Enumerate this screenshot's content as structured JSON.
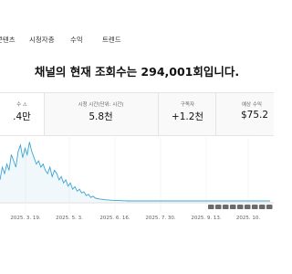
{
  "tabs": [
    "콘텐츠",
    "시청자층",
    "수익",
    "트렌드"
  ],
  "headline": "채널의 현재 조회수는 294,001회입니다.",
  "metrics": [
    {
      "label": "수 ⚠",
      "value": ".4만"
    },
    {
      "label": "시청 시간(단위: 시간)",
      "value": "5.8천"
    },
    {
      "label": "구독자",
      "value": "+1.2천"
    },
    {
      "label": "예상 수익",
      "value": "$75.2"
    }
  ],
  "colors": {
    "line": "#3ea6d1",
    "accent": "#065fd4"
  },
  "chart_data": {
    "type": "line",
    "x_tick_labels": [
      "2025. 3. 19.",
      "2025. 5. 3.",
      "2025. 6. 16.",
      "2025. 7. 30.",
      "2025. 9. 13.",
      "2025. 10."
    ],
    "series": [
      {
        "values": [
          0.35,
          0.55,
          0.45,
          0.6,
          0.5,
          0.75,
          0.65,
          0.55,
          0.8,
          0.9,
          0.7,
          0.85,
          0.75,
          0.95,
          0.8,
          0.7,
          0.6,
          0.65,
          0.55,
          0.6,
          0.5,
          0.45,
          0.55,
          0.4,
          0.5,
          0.45,
          0.35,
          0.4,
          0.3,
          0.35,
          0.25,
          0.3,
          0.2,
          0.24,
          0.17,
          0.2,
          0.14,
          0.16,
          0.1,
          0.12,
          0.07,
          0.09,
          0.06,
          0.05,
          0.045,
          0.04,
          0.035,
          0.03,
          0.03,
          0.025,
          0.025,
          0.02,
          0.02,
          0.02,
          0.018,
          0.018,
          0.015,
          0.015,
          0.015,
          0.015,
          0.015,
          0.015,
          0.015,
          0.015,
          0.015,
          0.015,
          0.015,
          0.015,
          0.015,
          0.015,
          0.015,
          0.015,
          0.015,
          0.015,
          0.015,
          0.015,
          0.015,
          0.015,
          0.015,
          0.015,
          0.015,
          0.015,
          0.015,
          0.015,
          0.015,
          0.015,
          0.015,
          0.015,
          0.015,
          0.015,
          0.015,
          0.015,
          0.015,
          0.015,
          0.015,
          0.015,
          0.015,
          0.015,
          0.015,
          0.015,
          0.015,
          0.015,
          0.015,
          0.015,
          0.015,
          0.015,
          0.015,
          0.015,
          0.015,
          0.015,
          0.015,
          0.015,
          0.015,
          0.015,
          0.015,
          0.015,
          0.015,
          0.015,
          0.015,
          0.015
        ]
      }
    ]
  }
}
